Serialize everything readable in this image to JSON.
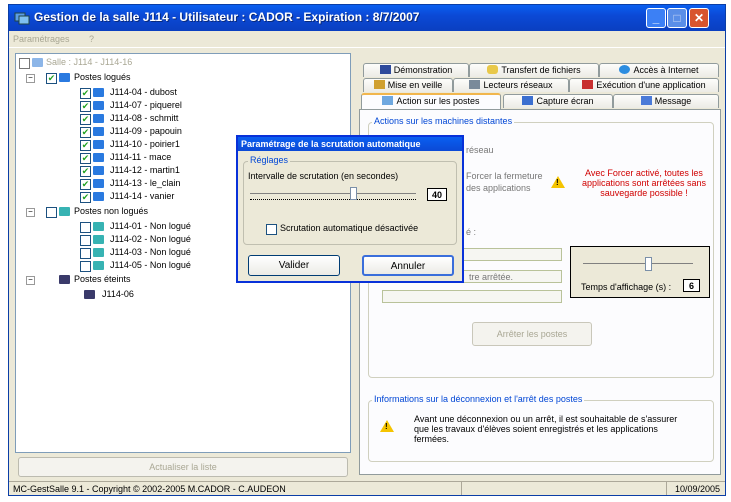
{
  "window": {
    "title": "Gestion de la salle J114 - Utilisateur : CADOR - Expiration  : 8/7/2007"
  },
  "menu": {
    "items": [
      "Paramétrages",
      "?"
    ]
  },
  "tree": {
    "root": "Salle : J114 - J114-16",
    "groups": [
      {
        "label": "Postes logués",
        "items": [
          "J114-04 - dubost",
          "J114-07 - piquerel",
          "J114-08 - schmitt",
          "J114-09 - papouin",
          "J114-10 - poirier1",
          "J114-11 - mace",
          "J114-12 - martin1",
          "J114-13 - le_clain",
          "J114-14 - vanier"
        ]
      },
      {
        "label": "Postes non logués",
        "items": [
          "J114-01 - Non logué",
          "J114-02 - Non logué",
          "J114-03 - Non logué",
          "J114-05 - Non logué"
        ]
      },
      {
        "label": "Postes éteints",
        "items": [
          "J114-06"
        ]
      }
    ],
    "refresh_label": "Actualiser la liste"
  },
  "tabs": {
    "row1": [
      "Démonstration",
      "Transfert de fichiers",
      "Accès à Internet"
    ],
    "row2": [
      "Mise en veille",
      "Lecteurs réseaux",
      "Exécution d'une application"
    ],
    "row3": [
      "Action sur les postes",
      "Capture écran",
      "Message"
    ]
  },
  "panel": {
    "group_title": "Actions sur les machines distantes",
    "reseau_text": "réseau",
    "force_line1": "Forcer la fermeture",
    "force_line2": "des applications",
    "warning_text": "Avec Forcer activé, toutes les applications sont arrêtées sans sauvegarde possible !",
    "colon": "é :",
    "field2_placeholder": "tre arrêtée.",
    "delay_label": "Temps d'affichage (s) :",
    "delay_value": "6",
    "stop_button": "Arrêter les postes",
    "info_title": "Informations sur la déconnexion et l'arrêt des postes",
    "info_text": "Avant une déconnexion ou un arrêt, il est souhaitable de s'assurer que les travaux d'élèves soient enregistrés et les applications fermées."
  },
  "dialog": {
    "title": "Paramétrage de la scrutation automatique",
    "group": "Réglages",
    "interval_label": "Intervalle de scrutation (en secondes)",
    "interval_value": "40",
    "checkbox_label": "Scrutation automatique désactivée",
    "ok": "Valider",
    "cancel": "Annuler"
  },
  "statusbar": {
    "copyright": "MC-GestSalle 9.1 - Copyright © 2002-2005  M.CADOR - C.AUDEON",
    "date": "10/09/2005"
  },
  "colors": {
    "titlebar": "#0b49d6",
    "dialog_title": "#0a5ff0",
    "warning_red": "#d00000",
    "group_blue": "#0046d5"
  }
}
